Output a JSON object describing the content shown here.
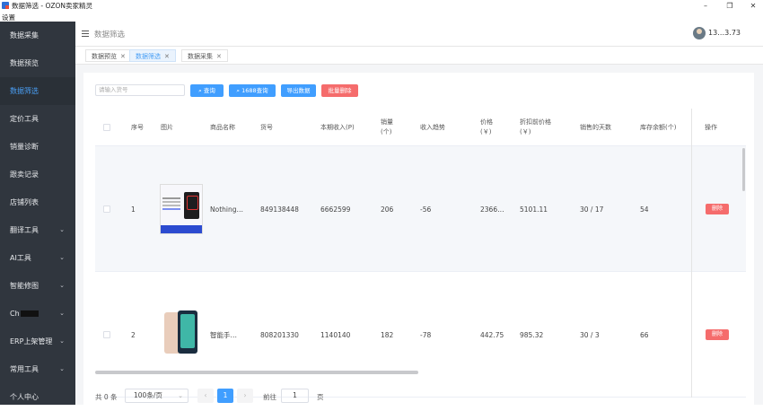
{
  "window": {
    "title": "数据筛选 - OZON卖家精灵",
    "minimize": "–",
    "maximize": "❐",
    "close": "✕"
  },
  "menubar": {
    "settings": "设置"
  },
  "sidebar": {
    "items": [
      {
        "label": "数据采集",
        "chevron": ""
      },
      {
        "label": "数据预览",
        "chevron": ""
      },
      {
        "label": "数据筛选",
        "chevron": ""
      },
      {
        "label": "定价工具",
        "chevron": ""
      },
      {
        "label": "销量诊断",
        "chevron": ""
      },
      {
        "label": "跟卖记录",
        "chevron": ""
      },
      {
        "label": "店铺列表",
        "chevron": ""
      },
      {
        "label": "翻译工具",
        "chevron": "⌄"
      },
      {
        "label": "AI工具",
        "chevron": "⌄"
      },
      {
        "label": "智能修图",
        "chevron": "⌄"
      },
      {
        "label": "Ch",
        "chevron": "⌄"
      },
      {
        "label": "ERP上架管理",
        "chevron": "⌄"
      },
      {
        "label": "常用工具",
        "chevron": "⌄"
      },
      {
        "label": "个人中心",
        "chevron": ""
      }
    ]
  },
  "header": {
    "breadcrumb": "数据筛选",
    "user_name": "13…3.73"
  },
  "tabs": [
    {
      "label": "数据预览",
      "close": "✕"
    },
    {
      "label": "数据筛选",
      "close": "✕"
    },
    {
      "label": "数据采集",
      "close": "✕"
    }
  ],
  "toolbar": {
    "search_placeholder": "请输入货号",
    "query_label": "查询",
    "query1688_label": "1688查询",
    "export_label": "导出数据",
    "batch_delete_label": "批量删除",
    "search_icon": "search-icon"
  },
  "table": {
    "columns": {
      "index": "序号",
      "image": "图片",
      "name": "商品名称",
      "sku": "货号",
      "revenue": "本期收入(P)",
      "sales": "销量\n(个)",
      "trend": "收入趋势",
      "price": "价格\n(￥)",
      "orig_price": "折扣前价格\n(￥)",
      "days": "销售的天数",
      "stock": "库存余额(个)",
      "ops": "操作"
    },
    "rows": [
      {
        "index": "1",
        "name": "Nothing…",
        "sku": "849138448",
        "revenue": "6662599",
        "sales": "206",
        "trend": "-56",
        "price": "2366…",
        "orig_price": "5101.11",
        "days": "30 / 17",
        "stock": "54",
        "op": "删除"
      },
      {
        "index": "2",
        "name": "智能手…",
        "sku": "808201330",
        "revenue": "1140140",
        "sales": "182",
        "trend": "-78",
        "price": "442.75",
        "orig_price": "985.32",
        "days": "30 / 3",
        "stock": "66",
        "op": "删除"
      }
    ]
  },
  "pagination": {
    "total": "共 0 条",
    "page_size": "100条/页",
    "page_size_arrow": "⌄",
    "prev": "‹",
    "current": "1",
    "next": "›",
    "goto_label": "前往",
    "goto_value": "1",
    "page_label": "页"
  }
}
